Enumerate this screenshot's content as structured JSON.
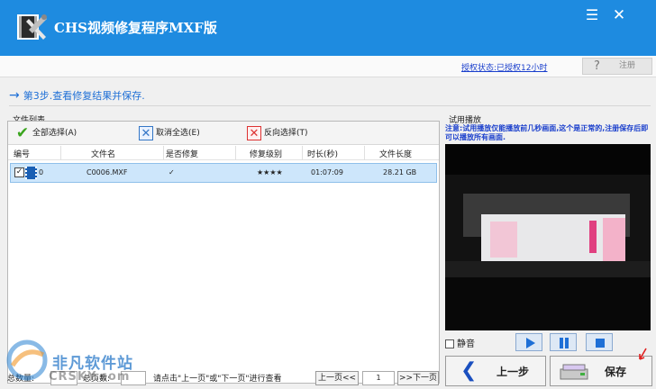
{
  "window": {
    "title": "CHS视频修复程序MXF版"
  },
  "license": {
    "status_link": "授权状态:已授权12小时",
    "register_label": "注册"
  },
  "step": {
    "text": "第3步.查看修复结果并保存."
  },
  "file_list": {
    "panel_label": "文件列表",
    "toolbar": {
      "select_all": "全部选择(A)",
      "deselect_all": "取消全选(E)",
      "invert": "反向选择(T)"
    },
    "columns": [
      "编号",
      "文件名",
      "是否修复",
      "修复级别",
      "时长(秒)",
      "文件长度"
    ],
    "rows": [
      {
        "index": "0",
        "filename": "C0006.MXF",
        "repaired": "✓",
        "level": "★★★★",
        "duration": "01:07:09",
        "size": "28.21 GB"
      }
    ]
  },
  "pager": {
    "total_label": "总数量:",
    "pages_label": "总页数:",
    "hint": "请点击\"上一页\"或\"下一页\"进行查看",
    "prev_label": "上一页<<",
    "page_value": "1",
    "next_label": ">>下一页"
  },
  "preview": {
    "label": "试用播放",
    "note": "注意:试用播放仅能播放前几秒画面,这个是正常的,注册保存后即可以播放所有画面.",
    "mute_label": "静音"
  },
  "actions": {
    "prev_step": "上一步",
    "save": "保存"
  },
  "watermark": {
    "text": "非凡软件站",
    "sub": "CRSKY.com"
  },
  "colors": {
    "titlebar": "#1e8be0",
    "accent_text": "#1e6fd6",
    "link": "#1a3fcc",
    "row_selected": "#cde6fb"
  }
}
